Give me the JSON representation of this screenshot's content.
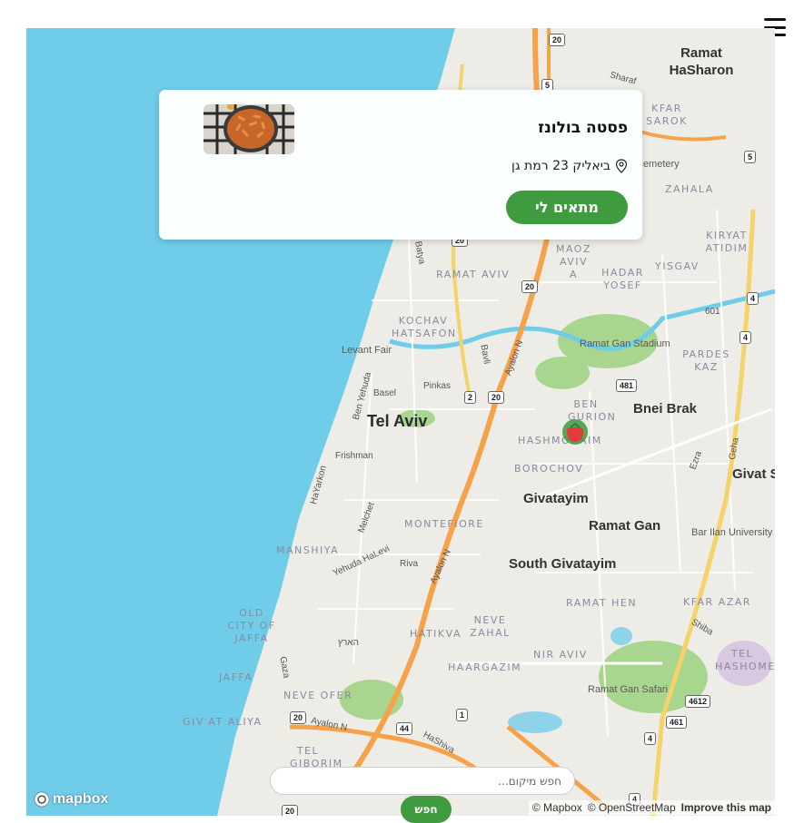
{
  "header": {
    "menu_icon": "hamburger-menu-icon"
  },
  "map": {
    "cities": [
      "Tel Aviv",
      "Bnei Brak",
      "Ramat Gan",
      "Givatayim",
      "South Givatayim",
      "Ramat HaSharon",
      "Givat S"
    ],
    "neighborhoods": [
      "RAMAT AVIV",
      "KOCHAV HATSAFON",
      "HASHMONAIM",
      "BOROCHOV",
      "BEN GURION",
      "MONTEFIORE",
      "MANSHIYA",
      "OLD CITY OF JAFFA",
      "JAFFA",
      "NEVE OFER",
      "GIV'AT ALIYA",
      "TEL GIBORIM",
      "HATIKVA",
      "NEVE ZAHAL",
      "HAARGAZIM",
      "NIR AVIV",
      "RAMAT HEN",
      "KFAR AZAR",
      "TEL HASHOMER",
      "PARDES KAZ",
      "YISGAV",
      "HADAR YOSEF",
      "MAOZ AVIV A",
      "ZAHALA",
      "KIRYAT ATIDIM",
      "KFAR SAROK"
    ],
    "streets": [
      "Ayalon N",
      "Ayalon N",
      "Ayalon N",
      "Basel",
      "Pinkas",
      "Bavli",
      "Frishman",
      "Ben Yehuda",
      "HaYarkon",
      "Melchet",
      "Yehuda HaLevi",
      "Riva",
      "Shiba",
      "Ezra",
      "Geha",
      "Gaza",
      "HaShiva",
      "Batya",
      "Sharaf",
      "הארץ"
    ],
    "pois": [
      "Levant Fair",
      "Ramat Gan Stadium",
      "Ramat Gan Safari",
      "Bar Ilan University",
      "Cemetery"
    ],
    "road_numbers": [
      "20",
      "5",
      "5",
      "20",
      "20",
      "2",
      "20",
      "481",
      "4",
      "4",
      "601",
      "4612",
      "461",
      "4",
      "1",
      "44",
      "20",
      "20",
      "4",
      "20"
    ],
    "marker_icon": "tomato-marker-icon"
  },
  "restaurant_card": {
    "name": "פסטה בולונז",
    "address": "ביאליק 23 רמת גן",
    "location_icon": "location-pin-icon",
    "match_button": "מתאים לי",
    "image_icon": "pasta-dish-image"
  },
  "search": {
    "placeholder": "חפש מיקום...",
    "button_label": "חפש"
  },
  "attribution": {
    "logo": "mapbox",
    "copyright_mapbox": "© Mapbox",
    "copyright_osm": "© OpenStreetMap",
    "improve": "Improve this map"
  },
  "colors": {
    "water": "#6fcde9",
    "land": "#eeece6",
    "park": "#a9d68e",
    "major_road": "#f5a24b",
    "accent_green": "#3f9a40"
  }
}
